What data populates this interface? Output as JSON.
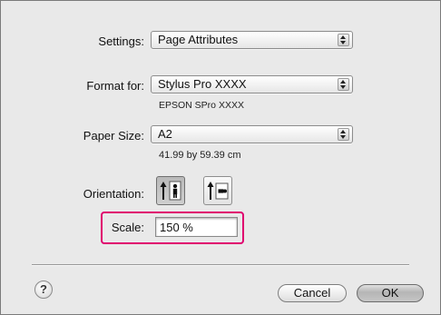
{
  "settings": {
    "label": "Settings:",
    "value": "Page Attributes"
  },
  "format_for": {
    "label": "Format for:",
    "value": "Stylus Pro XXXX",
    "sub_text": "EPSON SPro XXXX"
  },
  "paper_size": {
    "label": "Paper Size:",
    "value": "A2",
    "dimensions": "41.99 by 59.39 cm"
  },
  "orientation": {
    "label": "Orientation:",
    "options": [
      "portrait",
      "landscape"
    ],
    "selected": "portrait"
  },
  "scale": {
    "label": "Scale:",
    "value": "150 %"
  },
  "buttons": {
    "help": "?",
    "cancel": "Cancel",
    "ok": "OK"
  },
  "colors": {
    "highlight": "#e0006f",
    "dialog_bg": "#e9e9e9"
  },
  "icons": [
    "chevron-updown-icon",
    "portrait-icon",
    "landscape-icon",
    "help-icon"
  ]
}
